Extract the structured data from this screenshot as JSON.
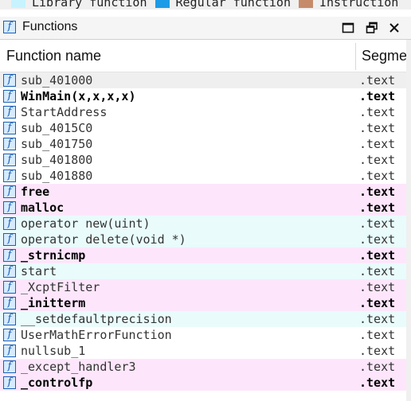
{
  "legend": [
    {
      "label": "Library function",
      "color": "#c7f3ff"
    },
    {
      "label": "Regular function",
      "color": "#1e9be6"
    },
    {
      "label": "Instruction",
      "color": "#c68b6a"
    }
  ],
  "panel": {
    "title": "Functions",
    "icon": "function-icon",
    "controls": [
      "maximize-icon",
      "float-icon",
      "close-icon"
    ]
  },
  "table": {
    "columns": [
      "Function name",
      "Segme"
    ],
    "rows": [
      {
        "name": "sub_401000",
        "segment": ".text",
        "bold": false,
        "style": "sel"
      },
      {
        "name": "WinMain(x,x,x,x)",
        "segment": ".text",
        "bold": true,
        "style": ""
      },
      {
        "name": "StartAddress",
        "segment": ".text",
        "bold": false,
        "style": ""
      },
      {
        "name": "sub_4015C0",
        "segment": ".text",
        "bold": false,
        "style": ""
      },
      {
        "name": "sub_401750",
        "segment": ".text",
        "bold": false,
        "style": ""
      },
      {
        "name": "sub_401800",
        "segment": ".text",
        "bold": false,
        "style": ""
      },
      {
        "name": "sub_401880",
        "segment": ".text",
        "bold": false,
        "style": ""
      },
      {
        "name": "free",
        "segment": ".text",
        "bold": true,
        "style": "lib"
      },
      {
        "name": "malloc",
        "segment": ".text",
        "bold": true,
        "style": "lib"
      },
      {
        "name": "operator new(uint)",
        "segment": ".text",
        "bold": false,
        "style": "ins"
      },
      {
        "name": "operator delete(void *)",
        "segment": ".text",
        "bold": false,
        "style": "ins"
      },
      {
        "name": "_strnicmp",
        "segment": ".text",
        "bold": true,
        "style": "lib"
      },
      {
        "name": "start",
        "segment": ".text",
        "bold": false,
        "style": "ins"
      },
      {
        "name": "_XcptFilter",
        "segment": ".text",
        "bold": false,
        "style": "lib"
      },
      {
        "name": "_initterm",
        "segment": ".text",
        "bold": true,
        "style": "lib"
      },
      {
        "name": "__setdefaultprecision",
        "segment": ".text",
        "bold": false,
        "style": "ins"
      },
      {
        "name": "UserMathErrorFunction",
        "segment": ".text",
        "bold": false,
        "style": ""
      },
      {
        "name": "nullsub_1",
        "segment": ".text",
        "bold": false,
        "style": ""
      },
      {
        "name": "_except_handler3",
        "segment": ".text",
        "bold": false,
        "style": "lib"
      },
      {
        "name": "_controlfp",
        "segment": ".text",
        "bold": true,
        "style": "lib"
      }
    ]
  }
}
